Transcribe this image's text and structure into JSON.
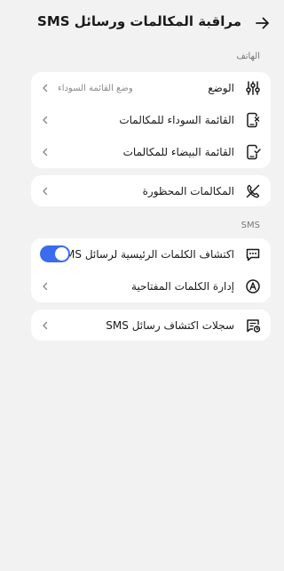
{
  "header": {
    "title": "مراقبة المكالمات ورسائل SMS",
    "back_icon": "arrow-right-icon"
  },
  "phone_section": {
    "label": "الهاتف",
    "items": [
      {
        "label": "الوضع",
        "value": "وضع القائمة السوداء",
        "icon": "sliders-icon"
      },
      {
        "label": "القائمة السوداء للمكالمات",
        "icon": "phone-block-icon"
      },
      {
        "label": "القائمة البيضاء للمكالمات",
        "icon": "phone-allow-icon"
      }
    ],
    "blocked": {
      "label": "المكالمات المحظورة",
      "icon": "blocked-call-icon"
    }
  },
  "sms_section": {
    "label": "SMS",
    "items": [
      {
        "label": "اكتشاف الكلمات الرئيسية لرسائل SMS",
        "icon": "message-icon",
        "toggle_on": true
      },
      {
        "label": "إدارة الكلمات المفتاحية",
        "icon": "keyword-icon"
      }
    ],
    "logs": {
      "label": "سجلات اكتشاف رسائل SMS",
      "icon": "message-log-icon"
    }
  },
  "colors": {
    "accent": "#3a6cf0",
    "background": "#f2f2f2",
    "card": "#ffffff"
  }
}
